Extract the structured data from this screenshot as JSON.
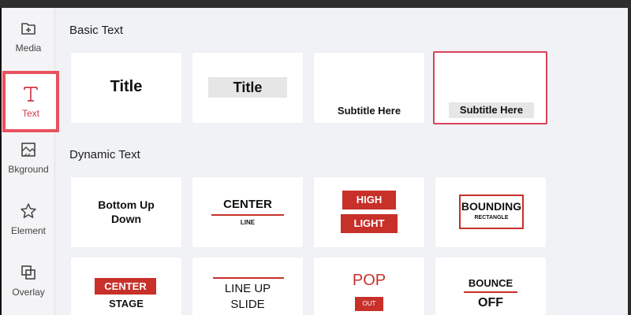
{
  "sidebar": {
    "items": [
      {
        "label": "Media",
        "icon": "add-media-icon",
        "active": false
      },
      {
        "label": "Text",
        "icon": "text-icon",
        "active": true
      },
      {
        "label": "Bkground",
        "icon": "background-icon",
        "active": false
      },
      {
        "label": "Element",
        "icon": "star-icon",
        "active": false
      },
      {
        "label": "Overlay",
        "icon": "overlay-icon",
        "active": false
      }
    ]
  },
  "sections": {
    "basic": {
      "title": "Basic Text",
      "cards": [
        {
          "text": "Title",
          "style": "plain"
        },
        {
          "text": "Title",
          "style": "boxed"
        },
        {
          "text": "Subtitle Here",
          "style": "plain"
        },
        {
          "text": "Subtitle Here",
          "style": "boxed",
          "selected": true
        }
      ]
    },
    "dynamic": {
      "title": "Dynamic Text",
      "cards": {
        "bottom_up_down": {
          "line1": "Bottom Up",
          "line2": "Down"
        },
        "center_line": {
          "main": "CENTER",
          "sub": "LINE"
        },
        "highlight": {
          "top": "HIGH",
          "bottom": "LIGHT"
        },
        "bounding": {
          "main": "BOUNDING",
          "sub": "RECTANGLE"
        },
        "center_stage": {
          "box": "CENTER",
          "sub": "STAGE"
        },
        "line_up_slide": {
          "line1": "LINE UP",
          "line2": "SLIDE"
        },
        "pop_out": {
          "main": "POP",
          "sub": "OUT"
        },
        "bounce_off": {
          "main": "BOUNCE",
          "sub": "OFF"
        }
      }
    }
  },
  "colors": {
    "accent": "#e8525e",
    "brand_red": "#c8302a",
    "background": "#f1f2f5",
    "card": "#ffffff"
  }
}
